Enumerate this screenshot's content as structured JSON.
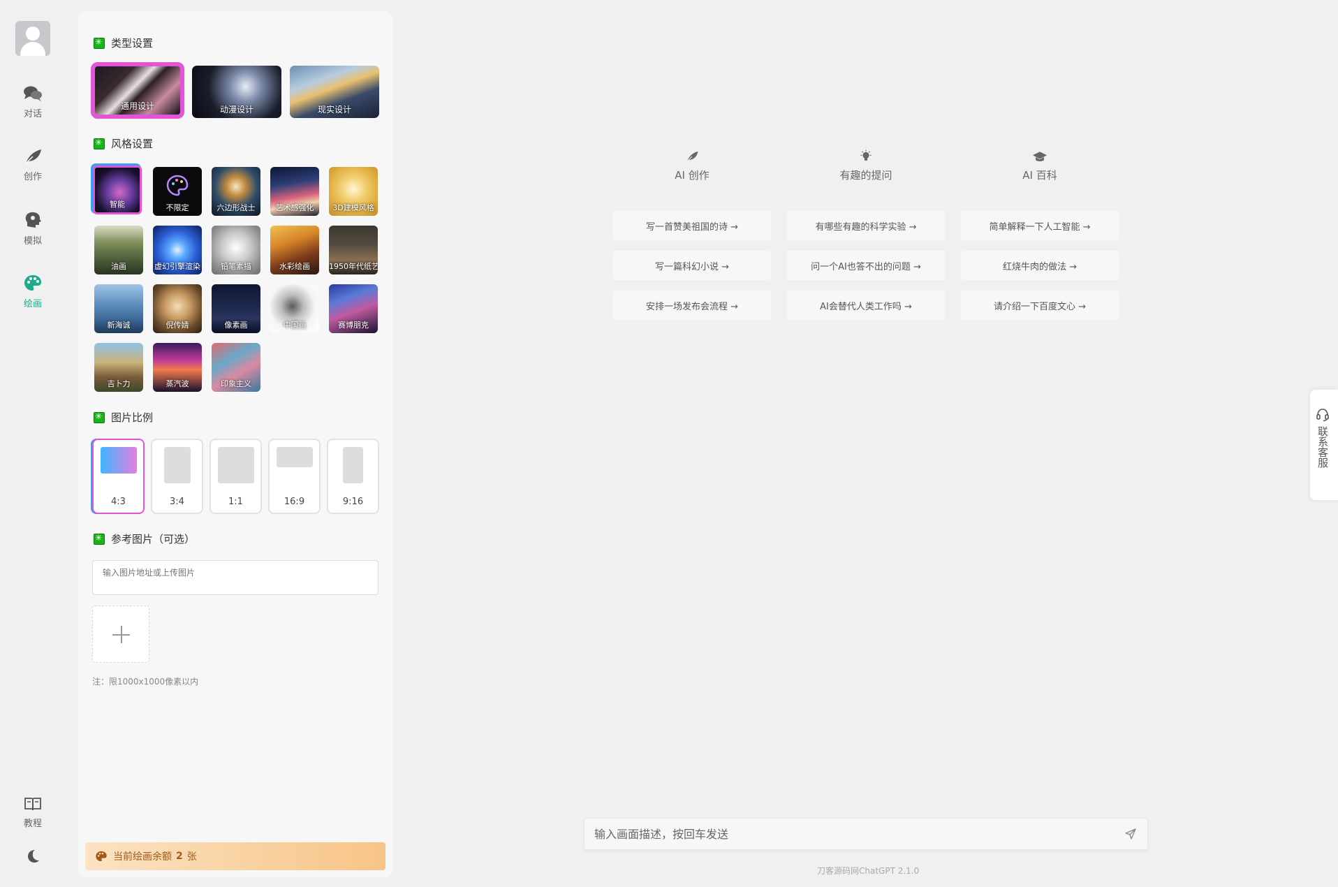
{
  "nav": {
    "items": [
      {
        "label": "对话",
        "icon": "chat-bubbles-icon"
      },
      {
        "label": "创作",
        "icon": "feather-icon"
      },
      {
        "label": "模拟",
        "icon": "head-icon"
      },
      {
        "label": "绘画",
        "icon": "palette-icon"
      }
    ],
    "tutorial": "教程",
    "theme_icon": "moon-icon"
  },
  "panel": {
    "type_title": "类型设置",
    "types": [
      "通用设计",
      "动漫设计",
      "现实设计"
    ],
    "style_title": "风格设置",
    "styles": [
      "智能",
      "不限定",
      "六边形战士",
      "艺术感强化",
      "3D建模风格",
      "油画",
      "虚幻引擎渲染",
      "铅笔素描",
      "水彩绘画",
      "1950年代纸艺",
      "新海诚",
      "倪传婧",
      "像素画",
      "中国画",
      "赛博朋克",
      "吉卜力",
      "蒸汽波",
      "印象主义"
    ],
    "ratio_title": "图片比例",
    "ratios": [
      "4:3",
      "3:4",
      "1:1",
      "16:9",
      "9:16"
    ],
    "ref_title": "参考图片（可选）",
    "ref_placeholder": "输入图片地址或上传图片",
    "note": "注：限1000x1000像素以内",
    "quota_prefix": "当前绘画余额",
    "quota_count": "2",
    "quota_unit": "张"
  },
  "main": {
    "columns": [
      {
        "title": "AI 创作",
        "icon": "feather-icon",
        "prompts": [
          "写一首赞美祖国的诗 →",
          "写一篇科幻小说 →",
          "安排一场发布会流程 →"
        ]
      },
      {
        "title": "有趣的提问",
        "icon": "lightbulb-icon",
        "prompts": [
          "有哪些有趣的科学实验 →",
          "问一个AI也答不出的问题 →",
          "AI会替代人类工作吗 →"
        ]
      },
      {
        "title": "AI 百科",
        "icon": "graduation-cap-icon",
        "prompts": [
          "简单解释一下人工智能 →",
          "红烧牛肉的做法 →",
          "请介绍一下百度文心 →"
        ]
      }
    ],
    "input_placeholder": "输入画面描述，按回车发送",
    "footer": "刀客源码网ChatGPT 2.1.0"
  },
  "service": {
    "label": "联系客服"
  },
  "colors": {
    "accent": "#1cab8b",
    "select_pink": "#e354d6",
    "select_blue": "#3aa0f0"
  }
}
